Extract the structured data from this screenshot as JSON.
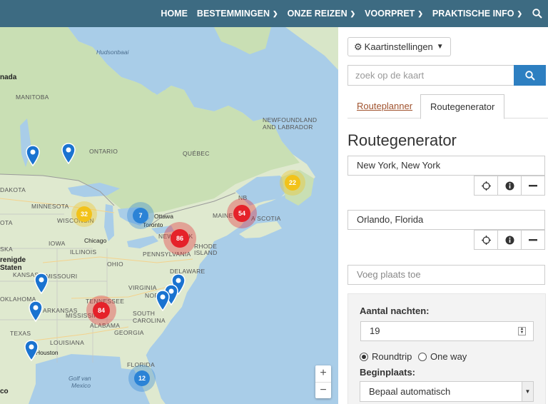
{
  "nav": {
    "items": [
      {
        "label": "HOME",
        "dropdown": false
      },
      {
        "label": "BESTEMMINGEN",
        "dropdown": true
      },
      {
        "label": "ONZE REIZEN",
        "dropdown": true
      },
      {
        "label": "VOORPRET",
        "dropdown": true
      },
      {
        "label": "PRAKTISCHE INFO",
        "dropdown": true
      }
    ],
    "search_icon": "search-icon",
    "background": "#3d6b82"
  },
  "map": {
    "labels": {
      "hudson": "Hudsonbaai",
      "nada": "nada",
      "manitoba": "MANITOBA",
      "ontario": "ONTARIO",
      "quebec": "QUÉBEC",
      "newfoundland": "NEWFOUNDLAND",
      "and_labrador": "AND LABRADOR",
      "dakota": "DAKOTA",
      "minnesota": "MINNESOTA",
      "ota": "OTA",
      "ska": "SKA",
      "wisconsin": "WISCONSIN",
      "chicago": "Chicago",
      "ottawa": "Ottawa",
      "toronto": "Toronto",
      "new_york": "NEW YORK",
      "pennsylvania": "PENNSYLVANIA",
      "iowa": "IOWA",
      "illinois": "ILLINOIS",
      "ohio": "OHIO",
      "nebraska": "NEBRASKA",
      "verenigde": "renigde",
      "staten": "Staten",
      "kansas": "KANSAS",
      "missouri": "MISSOURI",
      "virginia": "VIRGINIA",
      "oklahoma": "OKLAHOMA",
      "tennessee": "TENNESSEE",
      "north": "NORTH",
      "south": "SOUTH",
      "carolina": "CAROLINA",
      "arkansas": "ARKANSAS",
      "mississippi": "MISSISSIPPI",
      "alabama": "ALABAMA",
      "georgia": "GEORGIA",
      "texas": "TEXAS",
      "louisiana": "LOUISIANA",
      "houston": "Houston",
      "florida": "FLORIDA",
      "gulf": "Golf van",
      "mexico": "Mexico",
      "co": "co",
      "delaware": "DELAWARE",
      "rhode": "RHODE",
      "island": "ISLAND",
      "maine": "MAINE",
      "nb": "NB",
      "scotia": "A SCOTIA"
    },
    "clusters": [
      {
        "count": "22",
        "color": "#f2c21a"
      },
      {
        "count": "32",
        "color": "#f2c21a"
      },
      {
        "count": "7",
        "color": "#2b83d6"
      },
      {
        "count": "54",
        "color": "#e5222a"
      },
      {
        "count": "86",
        "color": "#e5222a"
      },
      {
        "count": "84",
        "color": "#e5222a"
      },
      {
        "count": "12",
        "color": "#2b83d6"
      }
    ],
    "pin_color": "#1a73d0",
    "zoom_in": "+",
    "zoom_out": "−"
  },
  "panel": {
    "settings_label": "Kaartinstellingen",
    "search_placeholder": "zoek op de kaart",
    "tabs": [
      {
        "label": "Routeplanner",
        "active": false
      },
      {
        "label": "Routegenerator",
        "active": true
      }
    ],
    "heading": "Routegenerator",
    "stops": [
      {
        "value": "New York, New York"
      },
      {
        "value": "Orlando, Florida"
      }
    ],
    "add_stop_placeholder": "Voeg plaats toe",
    "nights_label": "Aantal nachten:",
    "nights_value": "19",
    "roundtrip_label": "Roundtrip",
    "oneway_label": "One way",
    "start_label": "Beginplaats:",
    "start_value": "Bepaal automatisch",
    "accent": "#2d7fc1"
  }
}
